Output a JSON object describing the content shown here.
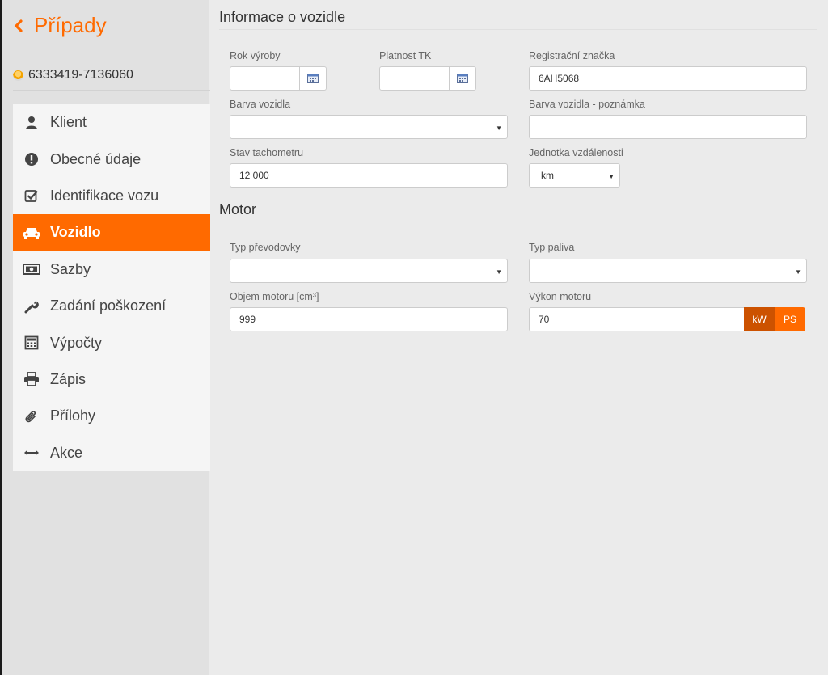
{
  "sidebar": {
    "back_label": "Případy",
    "case_id": "6333419-7136060",
    "items": [
      {
        "label": "Klient",
        "icon": "user-icon"
      },
      {
        "label": "Obecné údaje",
        "icon": "exclamation-circle-icon"
      },
      {
        "label": "Identifikace vozu",
        "icon": "checkbox-icon"
      },
      {
        "label": "Vozidlo",
        "icon": "car-icon",
        "active": true
      },
      {
        "label": "Sazby",
        "icon": "money-icon"
      },
      {
        "label": "Zadání poškození",
        "icon": "wrench-icon"
      },
      {
        "label": "Výpočty",
        "icon": "calculator-icon"
      },
      {
        "label": "Zápis",
        "icon": "printer-icon"
      },
      {
        "label": "Přílohy",
        "icon": "paperclip-icon"
      },
      {
        "label": "Akce",
        "icon": "arrows-horizontal-icon"
      }
    ]
  },
  "vehicle_info": {
    "title": "Informace o vozidle",
    "year_label": "Rok výroby",
    "year_value": "",
    "tk_label": "Platnost TK",
    "tk_value": "",
    "plate_label": "Registrační značka",
    "plate_value": "6AH5068",
    "color_label": "Barva vozidla",
    "color_value": "",
    "color_note_label": "Barva vozidla - poznámka",
    "color_note_value": "",
    "odometer_label": "Stav tachometru",
    "odometer_value": "12 000",
    "distance_unit_label": "Jednotka vzdálenosti",
    "distance_unit_value": "km"
  },
  "motor": {
    "title": "Motor",
    "gearbox_label": "Typ převodovky",
    "gearbox_value": "",
    "fuel_label": "Typ paliva",
    "fuel_value": "",
    "volume_label": "Objem motoru [cm³]",
    "volume_value": "999",
    "power_label": "Výkon motoru",
    "power_value": "70",
    "unit_kw": "kW",
    "unit_ps": "PS"
  },
  "colors": {
    "accent": "#ff6a00",
    "accent_dark": "#cc5200"
  }
}
